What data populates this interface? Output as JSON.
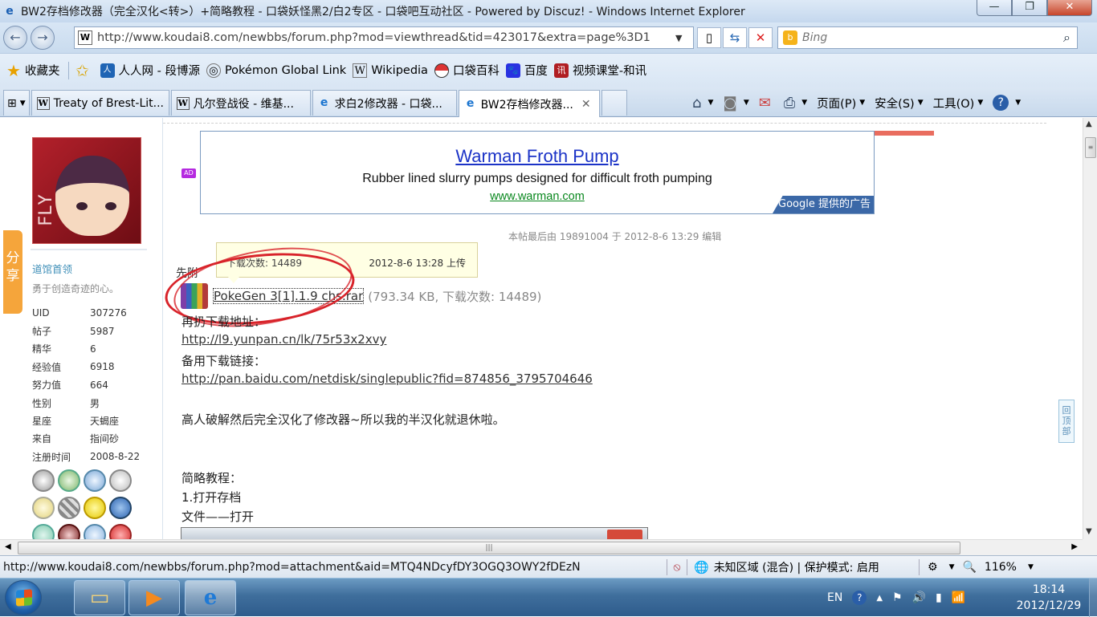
{
  "window": {
    "title": "BW2存档修改器（完全汉化<转>）+简略教程 - 口袋妖怪黑2/白2专区 - 口袋吧互动社区 - Powered by Discuz! - Windows Internet Explorer",
    "min": "—",
    "max": "❐",
    "close": "✕"
  },
  "address": {
    "url": "http://www.koudai8.com/newbbs/forum.php?mod=viewthread&tid=423017&extra=page%3D1",
    "search_placeholder": "Bing"
  },
  "favorites": {
    "label": "收藏夹",
    "items": [
      {
        "label": "人人网 - 段博源",
        "icon": "renren-icon"
      },
      {
        "label": "Pokémon Global Link",
        "icon": "pgl-icon"
      },
      {
        "label": "Wikipedia",
        "icon": "wikipedia-icon"
      },
      {
        "label": "口袋百科",
        "icon": "pokeball-icon"
      },
      {
        "label": "百度",
        "icon": "baidu-icon"
      },
      {
        "label": "视频课堂-和讯",
        "icon": "hexun-icon"
      }
    ]
  },
  "tabs": [
    {
      "label": "Treaty of Brest-Lit..."
    },
    {
      "label": "凡尔登战役 - 维基..."
    },
    {
      "label": "求白2修改器 - 口袋..."
    },
    {
      "label": "BW2存档修改器..."
    }
  ],
  "commandbar": {
    "page": "页面(P)",
    "safety": "安全(S)",
    "tools": "工具(O)"
  },
  "sidebar": {
    "share": "分享",
    "user_group": "道馆首领",
    "motto": "勇于创造奇迹的心。",
    "stats": [
      {
        "k": "UID",
        "v": "307276"
      },
      {
        "k": "帖子",
        "v": "5987"
      },
      {
        "k": "精华",
        "v": "6"
      },
      {
        "k": "经验值",
        "v": "6918"
      },
      {
        "k": "努力值",
        "v": "664"
      },
      {
        "k": "性别",
        "v": "男"
      },
      {
        "k": "星座",
        "v": "天蝎座"
      },
      {
        "k": "来自",
        "v": "指间砂"
      },
      {
        "k": "注册时间",
        "v": "2008-8-22"
      }
    ],
    "avatar_text": "FLY"
  },
  "ad": {
    "badge": "AD",
    "title": "Warman Froth Pump",
    "description": "Rubber lined slurry pumps designed for difficult froth pumping",
    "url": "www.warman.com",
    "google": "Google 提供的广告"
  },
  "post": {
    "edited": "本帖最后由 19891004 于 2012-8-6 13:29 编辑",
    "tooltip_count": "下载次数: 14489",
    "tooltip_upload": "2012-8-6 13:28 上传",
    "attach_label": "先附",
    "attach_name": "PokeGen 3[1].1.9 chs.rar",
    "attach_meta": "(793.34 KB, 下载次数: 14489)",
    "line1": "再扔下载地址：",
    "link1": "http://l9.yunpan.cn/lk/75r53x2xvy",
    "line2": "备用下载链接：",
    "link2": "http://pan.baidu.com/netdisk/singlepublic?fid=874856_3795704646",
    "line3": "高人破解然后完全汉化了修改器~所以我的半汉化就退休啦。",
    "line4": "简略教程：",
    "line5": "1.打开存档",
    "line6": "文件——打开",
    "to_top": "回顶部"
  },
  "status": {
    "url": "http://www.koudai8.com/newbbs/forum.php?mod=attachment&aid=MTQ4NDcyfDY3OGQ3OWY2fDEzN",
    "zone": "未知区域 (混合) | 保护模式: 启用",
    "zoom": "116%"
  },
  "taskbar": {
    "lang": "EN",
    "time": "18:14",
    "date": "2012/12/29"
  },
  "colors": {
    "accent": "#1b33c7",
    "ad_url": "#08871d",
    "annotation": "#d8232a",
    "link": "#333333"
  }
}
